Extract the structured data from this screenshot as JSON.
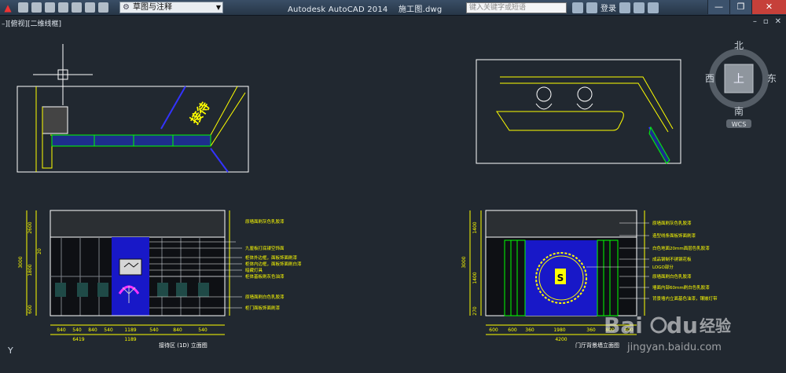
{
  "titlebar": {
    "app_title": "Autodesk AutoCAD 2014",
    "file_name": "施工图.dwg",
    "workspace": "草图与注释",
    "search_placeholder": "键入关键字或短语",
    "login_label": "登录",
    "minimize": "—",
    "restore": "❐",
    "close": "✕"
  },
  "viewport": {
    "label": "–][俯视][二维线框]",
    "ucs_y": "Y"
  },
  "viewcube": {
    "north": "北",
    "south": "南",
    "east": "东",
    "west": "西",
    "top": "上",
    "wcs": "WCS"
  },
  "drawing": {
    "plan_sign": "接待",
    "left_caption": "接待区 (1D) 立面图",
    "right_caption": "门厅背景墙立面图",
    "left_notes": [
      "原墙面刷灰色乳胶漆",
      "九厘板打底镂空饰面",
      "柜体外边框，面板饰面刷漆",
      "柜体内边框，面板饰面刷白漆",
      "暗藏灯具",
      "柜体基板刷灰色油漆",
      "原墙面刷白色乳胶漆",
      "柜门面板饰面刷漆"
    ],
    "right_notes": [
      "原墙面刷灰色乳胶漆",
      "造型线条面板饰面刷漆",
      "白色地面20mm面层色乳胶漆",
      "成品钢制不锈钢花板",
      "LOGO部分",
      "原墙面刷白色乳胶漆",
      "墙面内部60mm刷白色乳胶漆",
      "背景墙内立面基色油漆，镶嵌灯带"
    ],
    "left_dims": [
      "840",
      "540",
      "840",
      "540",
      "1189",
      "540",
      "840",
      "540"
    ],
    "left_total": "6419",
    "left_total_b": "1189",
    "right_dims": [
      "600",
      "600",
      "360",
      "1980",
      "360",
      "800",
      "600"
    ],
    "right_total": "4200",
    "left_vdims": [
      "3000",
      "2600",
      "1800",
      "600",
      "20"
    ],
    "right_vdims": [
      "3000",
      "1400",
      "1400",
      "270"
    ]
  },
  "watermark": {
    "brand": "Bai",
    "brand2": "du",
    "cn": "经验",
    "url": "jingyan.baidu.com"
  }
}
